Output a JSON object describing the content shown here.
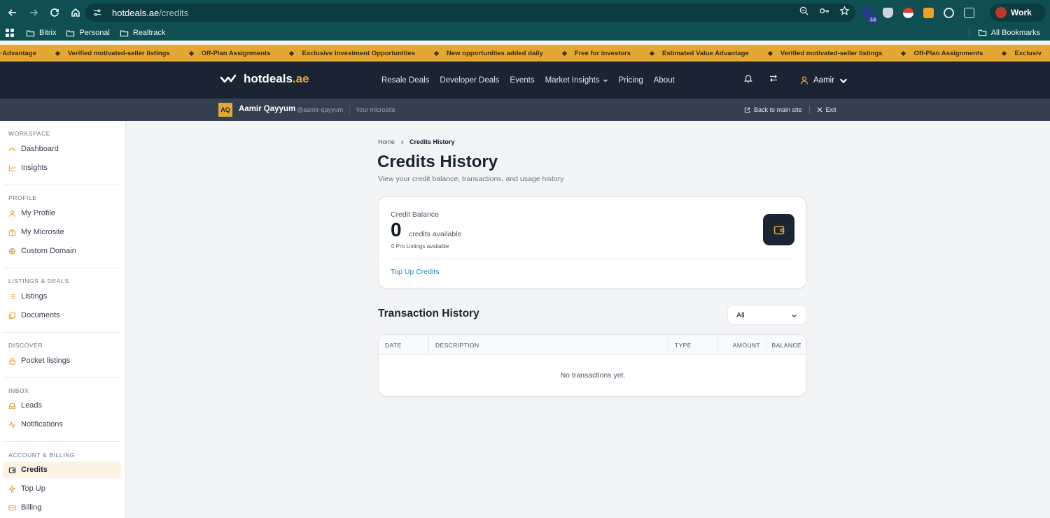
{
  "browser": {
    "url_host": "hotdeals.ae",
    "url_path": "/credits",
    "profile": "Work",
    "extension_badge": "13",
    "bookmarks": [
      "Bitrix",
      "Personal",
      "Realtrack"
    ],
    "all_bookmarks": "All Bookmarks"
  },
  "ticker": {
    "items": [
      "alue Advantage",
      "Verified motivated-seller listings",
      "Off-Plan Assignments",
      "Exclusive Investment Opportunities",
      "New opportunities added daily",
      "Free for investors",
      "Estimated Value Advantage",
      "Verified motivated-seller listings",
      "Off-Plan Assignments",
      "Exclusiv"
    ],
    "color": "#e5a734"
  },
  "header": {
    "logo_name": "hotdeals",
    "logo_tld": ".ae",
    "nav": {
      "resale": "Resale Deals",
      "developer": "Developer Deals",
      "events": "Events",
      "insights": "Market Insights",
      "pricing": "Pricing",
      "about": "About"
    },
    "user": "Aamir"
  },
  "microsite_bar": {
    "initials": "AQ",
    "name": "Aamir Qayyum",
    "handle": "@aamir-qayyum",
    "site_label": "Your microsite",
    "back": "Back to main site",
    "exit": "Exit"
  },
  "sidebar": {
    "sections": {
      "workspace": "WORKSPACE",
      "profile": "PROFILE",
      "listings": "LISTINGS & DEALS",
      "discover": "DISCOVER",
      "inbox": "INBOX",
      "billing": "ACCOUNT & BILLING"
    },
    "items": {
      "dashboard": "Dashboard",
      "insights": "Insights",
      "my_profile": "My Profile",
      "my_microsite": "My Microsite",
      "custom_domain": "Custom Domain",
      "listings": "Listings",
      "documents": "Documents",
      "pocket": "Pocket listings",
      "leads": "Leads",
      "notifications": "Notifications",
      "credits": "Credits",
      "topup": "Top Up",
      "billing": "Billing"
    }
  },
  "main": {
    "breadcrumb_home": "Home",
    "breadcrumb_current": "Credits History",
    "title": "Credits History",
    "subtitle": "View your credit balance, transactions, and usage history",
    "balance": {
      "label": "Credit Balance",
      "value": "0",
      "unit": "credits available",
      "pro": "0 Pro Listings available",
      "topup_link": "Top Up Credits"
    },
    "transactions": {
      "title": "Transaction History",
      "filter_value": "All",
      "columns": {
        "date": "DATE",
        "description": "DESCRIPTION",
        "type": "TYPE",
        "amount": "AMOUNT",
        "balance": "BALANCE"
      },
      "empty": "No transactions yet."
    }
  }
}
